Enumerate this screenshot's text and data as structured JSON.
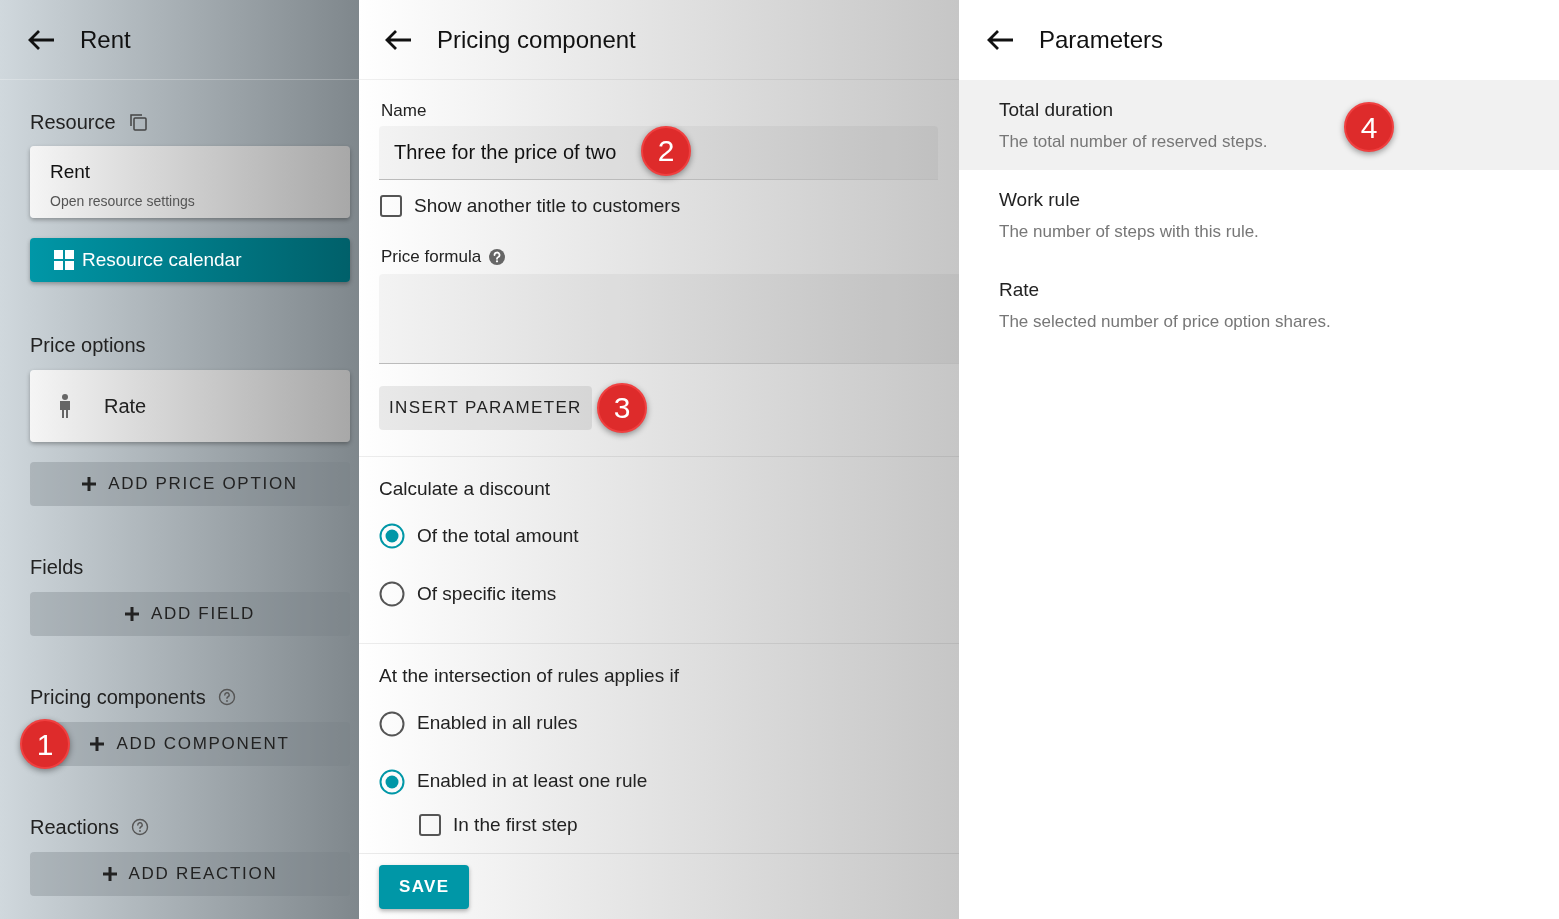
{
  "left_panel": {
    "title": "Rent",
    "resource": {
      "label": "Resource",
      "card_title": "Rent",
      "card_subtitle": "Open resource settings",
      "calendar_button": "Resource calendar"
    },
    "price_options": {
      "label": "Price options",
      "items": [
        {
          "label": "Rate"
        }
      ],
      "add_button": "ADD PRICE OPTION"
    },
    "fields": {
      "label": "Fields",
      "add_button": "ADD FIELD"
    },
    "pricing_components": {
      "label": "Pricing components",
      "add_button": "ADD COMPONENT",
      "callout": "1"
    },
    "reactions": {
      "label": "Reactions",
      "add_button": "ADD REACTION"
    }
  },
  "middle_panel": {
    "title": "Pricing component",
    "name_field": {
      "label": "Name",
      "value": "Three for the price of two",
      "callout": "2"
    },
    "alt_title_checkbox": {
      "label": "Show another title to customers",
      "checked": false
    },
    "formula_field": {
      "label": "Price formula"
    },
    "insert_button": {
      "label": "INSERT PARAMETER",
      "callout": "3"
    },
    "discount": {
      "title": "Calculate a discount",
      "options": [
        {
          "label": "Of the total amount",
          "selected": true
        },
        {
          "label": "Of specific items",
          "selected": false
        }
      ]
    },
    "intersection": {
      "title": "At the intersection of rules applies if",
      "options": [
        {
          "label": "Enabled in all rules",
          "selected": false
        },
        {
          "label": "Enabled in at least one rule",
          "selected": true
        }
      ],
      "sub_checkbox": {
        "label": "In the first step",
        "checked": false
      }
    },
    "save_button": "SAVE"
  },
  "right_panel": {
    "title": "Parameters",
    "items": [
      {
        "title": "Total duration",
        "description": "The total number of reserved steps.",
        "selected": true,
        "callout": "4"
      },
      {
        "title": "Work rule",
        "description": "The number of steps with this rule.",
        "selected": false
      },
      {
        "title": "Rate",
        "description": "The selected number of price option shares.",
        "selected": false
      }
    ]
  }
}
